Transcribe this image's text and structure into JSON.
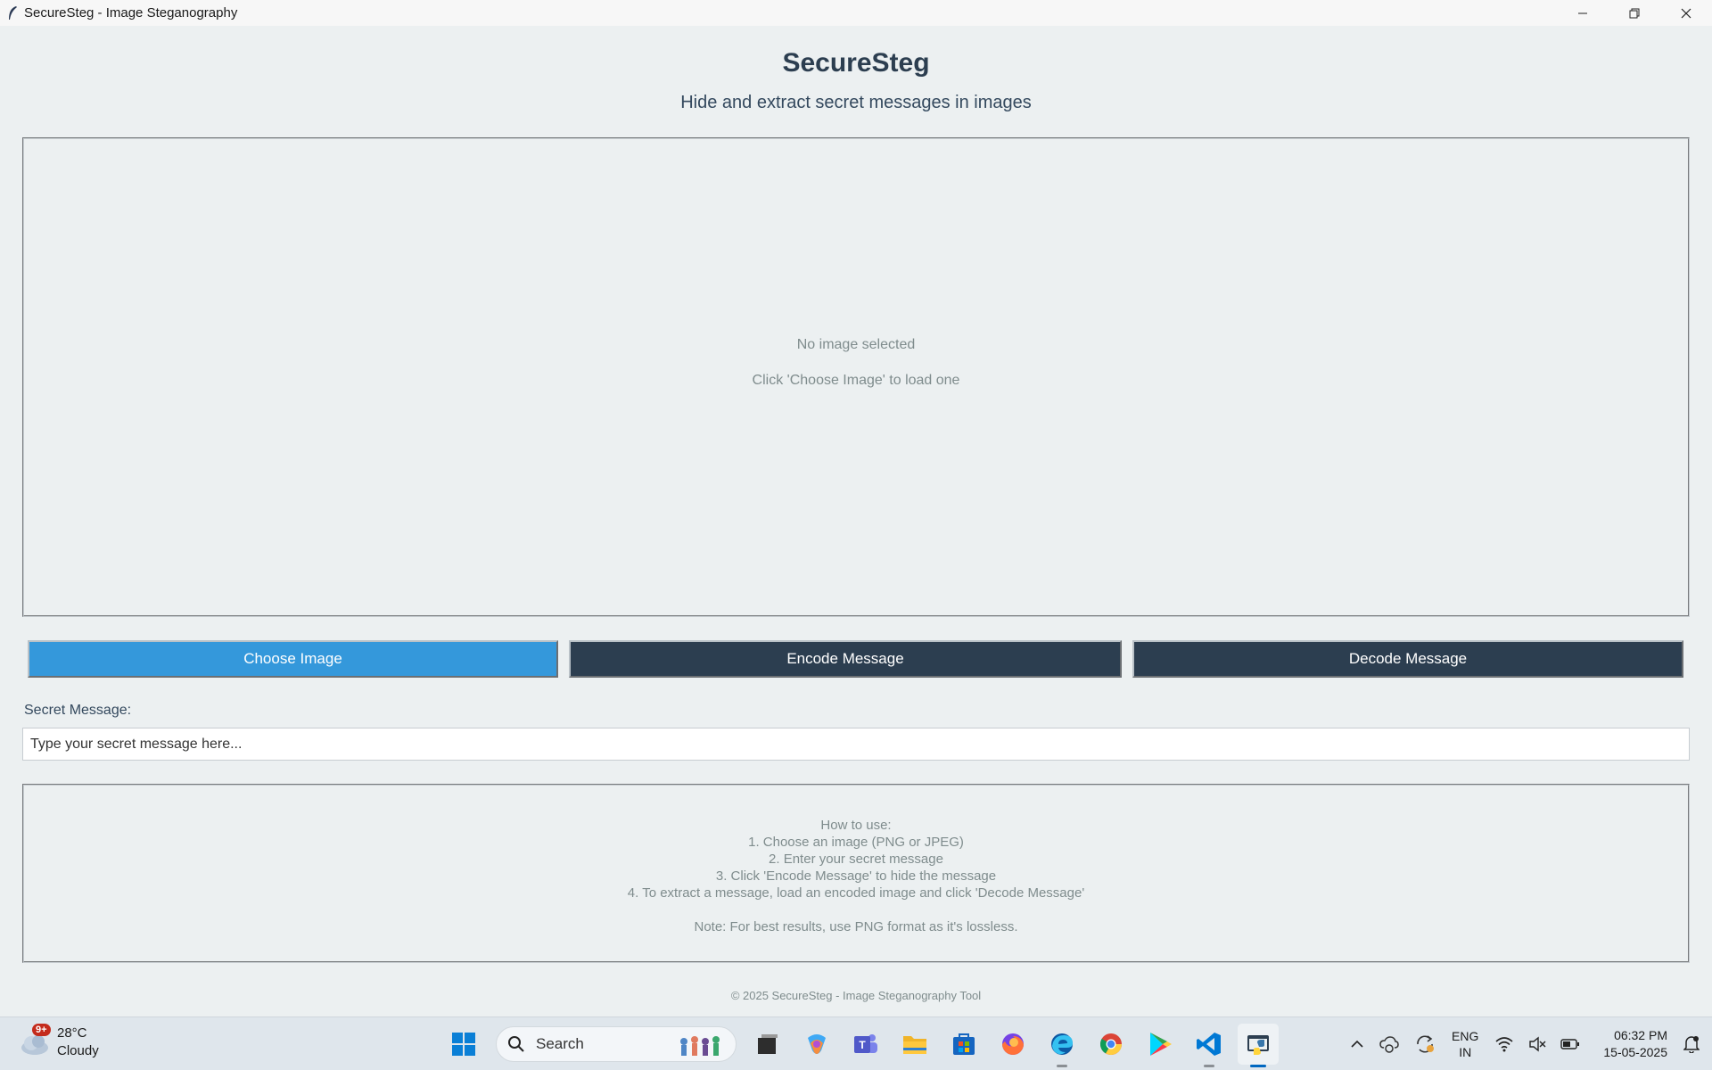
{
  "window": {
    "title": "SecureSteg - Image Steganography"
  },
  "app": {
    "title": "SecureSteg",
    "subtitle": "Hide and extract secret messages in images",
    "preview": {
      "empty_line1": "No image selected",
      "empty_line2": "Click 'Choose Image' to load one"
    },
    "buttons": {
      "choose": "Choose Image",
      "encode": "Encode Message",
      "decode": "Decode Message"
    },
    "message": {
      "label": "Secret Message:",
      "placeholder": "Type your secret message here..."
    },
    "howto": {
      "lines": [
        "How to use:",
        "1. Choose an image (PNG or JPEG)",
        "2. Enter your secret message",
        "3. Click 'Encode Message' to hide the message",
        "4. To extract a message, load an encoded image and click 'Decode Message'"
      ],
      "note": "Note: For best results, use PNG format as it's lossless."
    },
    "footer": "© 2025 SecureSteg - Image Steganography Tool",
    "colors": {
      "background": "#ecf0f1",
      "primary": "#3498db",
      "dark": "#2c3e50",
      "muted": "#7f8c8d"
    }
  },
  "taskbar": {
    "weather": {
      "badge": "9+",
      "temp": "28°C",
      "condition": "Cloudy"
    },
    "search_label": "Search",
    "icons": [
      "windows-start-icon",
      "task-view-icon",
      "copilot-icon",
      "teams-icon",
      "file-explorer-icon",
      "store-icon",
      "firefox-icon",
      "edge-icon",
      "chrome-icon",
      "play-store-icon",
      "vscode-icon",
      "python-app-icon"
    ],
    "tray": {
      "lang_line1": "ENG",
      "lang_line2": "IN",
      "time": "06:32 PM",
      "date": "15-05-2025"
    }
  }
}
